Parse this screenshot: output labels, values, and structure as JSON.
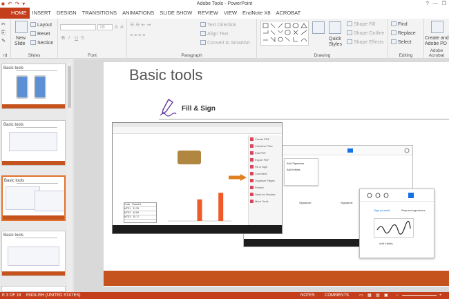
{
  "window": {
    "title": "Adobe Tools - PowerPoint",
    "help": "?",
    "minimize": "—",
    "restore": "❐"
  },
  "tabs": [
    {
      "label": "HOME",
      "active": true
    },
    {
      "label": "INSERT"
    },
    {
      "label": "DESIGN"
    },
    {
      "label": "TRANSITIONS"
    },
    {
      "label": "ANIMATIONS"
    },
    {
      "label": "SLIDE SHOW"
    },
    {
      "label": "REVIEW"
    },
    {
      "label": "VIEW"
    },
    {
      "label": "EndNote X8"
    },
    {
      "label": "ACROBAT"
    }
  ],
  "ribbon": {
    "slides": {
      "new_slide": "New",
      "new_slide2": "Slide",
      "layout": "Layout",
      "reset": "Reset",
      "section": "Section",
      "label": "Slides"
    },
    "clipboard": {
      "label": "rd"
    },
    "font": {
      "size": "18",
      "bold": "B",
      "italic": "I",
      "underline": "U",
      "strike": "S",
      "label": "Font"
    },
    "paragraph": {
      "text_direction": "Text Direction",
      "align_text": "Align Text",
      "smartart": "Convert to SmartArt",
      "label": "Paragraph"
    },
    "drawing": {
      "quick_styles": "Quick",
      "quick_styles2": "Styles",
      "shape_fill": "Shape Fill",
      "shape_outline": "Shape Outline",
      "shape_effects": "Shape Effects",
      "label": "Drawing"
    },
    "editing": {
      "find": "Find",
      "replace": "Replace",
      "select": "Select",
      "label": "Editing"
    },
    "acrobat": {
      "create": "Create and Sh",
      "adobe": "Adobe PD",
      "label": "Adobe Acrobat"
    }
  },
  "thumbnails": [
    {
      "title": "Basic tools"
    },
    {
      "title": "Basic tools"
    },
    {
      "title": "Basic tools",
      "selected": true
    },
    {
      "title": "Basic tools"
    },
    {
      "title": ""
    }
  ],
  "slide": {
    "title": "Basic tools",
    "subtitle": "Fill & Sign",
    "pane_items": [
      "Create PDF",
      "Combine Files",
      "Edit PDF",
      "Export PDF",
      "Fill & Sign",
      "Comment",
      "Organize Pages",
      "Protect",
      "Send for Review",
      "More Tools"
    ],
    "popup": [
      "Add Signature",
      "Add Initials"
    ],
    "sign_option": "Sign yourself",
    "sign_request": "Request signatures",
    "add_initials": "Add Initials",
    "table_header": [
      "Code",
      "Result%"
    ],
    "table_rows": [
      [
        "MTS1",
        "31.25"
      ],
      [
        "MTS2",
        "40.89"
      ],
      [
        "MTS3",
        "25.17"
      ]
    ],
    "sig_label1": "Signature:",
    "sig_label2": "Signature:"
  },
  "chart_data": {
    "type": "bar",
    "categories": [
      "1",
      "2",
      "3"
    ],
    "values": [
      0,
      31.25,
      40.89
    ],
    "title": "",
    "xlabel": "",
    "ylabel": "",
    "ylim": [
      0,
      50
    ]
  },
  "status": {
    "slide_counter": "E 3 OF 18",
    "language": "ENGLISH (UNITED STATES)",
    "notes": "NOTES",
    "comments": "COMMENTS",
    "zoom_minus": "−",
    "zoom_plus": "+"
  },
  "colors": {
    "accent": "#c43e1c",
    "slide_bar": "#c4531d",
    "chart_bar": "#f05a28"
  }
}
